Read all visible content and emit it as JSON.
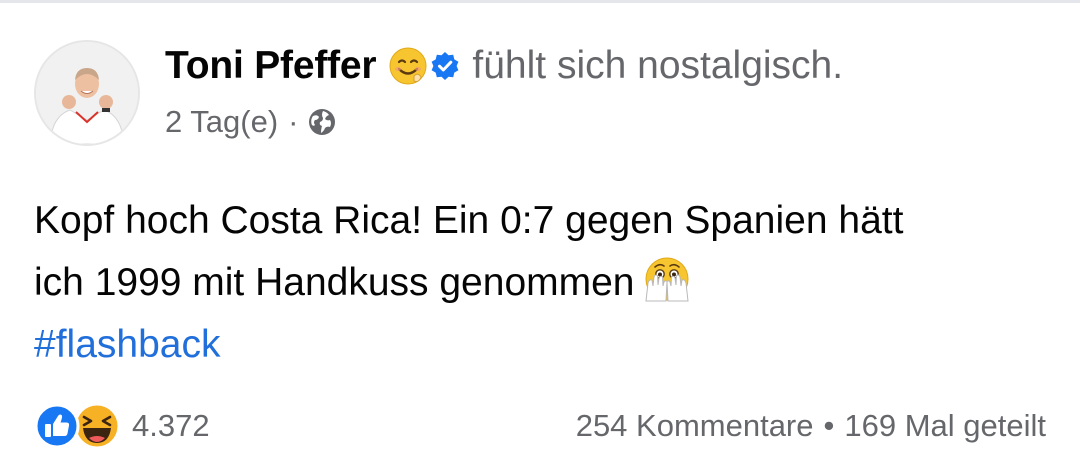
{
  "post": {
    "author": "Toni Pfeffer",
    "feeling_emoji_icon": "smiling-face-icon",
    "verified_icon": "verified-badge-icon",
    "feeling": "fühlt sich nostalgisch.",
    "time": "2 Tag(e)",
    "meta_separator": "·",
    "audience_icon": "globe-icon",
    "body_line_1": "Kopf hoch Costa Rica! Ein 0:7 gegen Spanien hätt",
    "body_line_2": "ich 1999 mit Handkuss genommen",
    "body_emoji_icon": "face-with-open-eyes-and-hand-over-mouth-icon",
    "hashtag": "#flashback"
  },
  "stats": {
    "reaction_icons": [
      "like-icon",
      "haha-icon"
    ],
    "reaction_count": "4.372",
    "comments": "254 Kommentare",
    "separator": "•",
    "shares": "169 Mal geteilt"
  },
  "colors": {
    "text_primary": "#050505",
    "text_secondary": "#65676b",
    "link": "#216fdb",
    "like_blue": "#1877f2",
    "haha_yellow": "#f7b125"
  }
}
